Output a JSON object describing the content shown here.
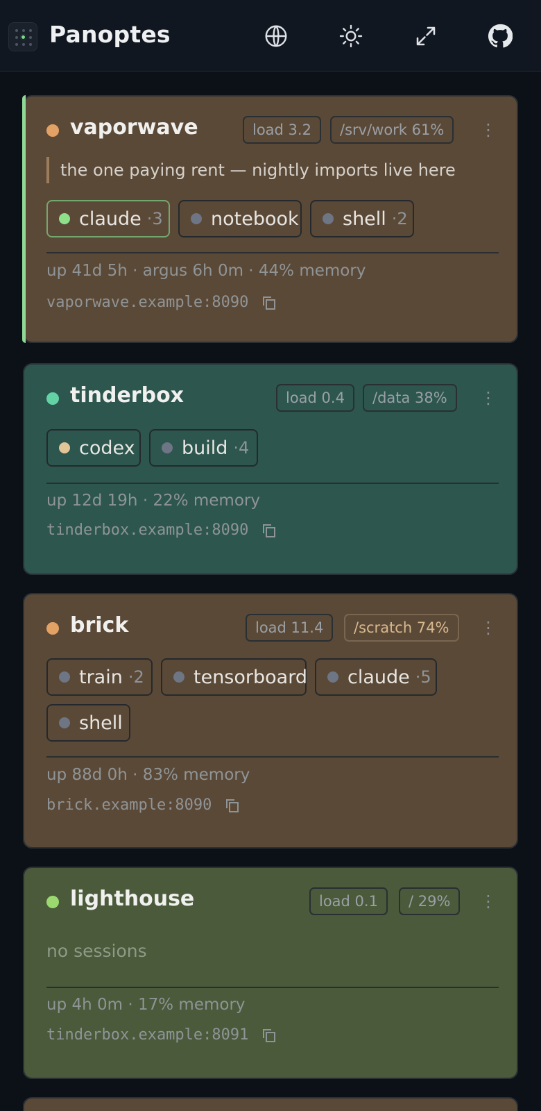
{
  "app": {
    "title": "Panoptes"
  },
  "header_icons": [
    "globe-icon",
    "sun-icon",
    "fullscreen-icon",
    "github-icon"
  ],
  "colors": {
    "status_orange": "#e3a265",
    "status_teal": "#63d3a5",
    "status_green": "#9bd870",
    "session_green": "#8ee08b",
    "session_tan": "#e2c597",
    "session_gray": "#6e7584"
  },
  "hosts": [
    {
      "name": "vaporwave",
      "load": "load 3.2",
      "disk": "/srv/work 61%",
      "note": "the one paying rent — nightly imports live here",
      "sessions": [
        {
          "name": "claude",
          "count": "·3"
        },
        {
          "name": "notebook",
          "count": ""
        },
        {
          "name": "shell",
          "count": "·2"
        }
      ],
      "meta": "up 41d 5h · argus 6h 0m · 44% memory",
      "address": "vaporwave.example:8090"
    },
    {
      "name": "tinderbox",
      "load": "load 0.4",
      "disk": "/data 38%",
      "sessions": [
        {
          "name": "codex",
          "count": ""
        },
        {
          "name": "build",
          "count": "·4"
        }
      ],
      "meta": "up 12d 19h · 22% memory",
      "address": "tinderbox.example:8090"
    },
    {
      "name": "brick",
      "load": "load 11.4",
      "disk": "/scratch 74%",
      "sessions": [
        {
          "name": "train",
          "count": "·2"
        },
        {
          "name": "tensorboard",
          "count": ""
        },
        {
          "name": "claude",
          "count": "·5"
        },
        {
          "name": "shell",
          "count": ""
        }
      ],
      "meta": "up 88d 0h · 83% memory",
      "address": "brick.example:8090"
    },
    {
      "name": "lighthouse",
      "load": "load 0.1",
      "disk": "/ 29%",
      "empty_text": "no sessions",
      "meta": "up 4h 0m · 17% memory",
      "address": "tinderbox.example:8091"
    }
  ]
}
